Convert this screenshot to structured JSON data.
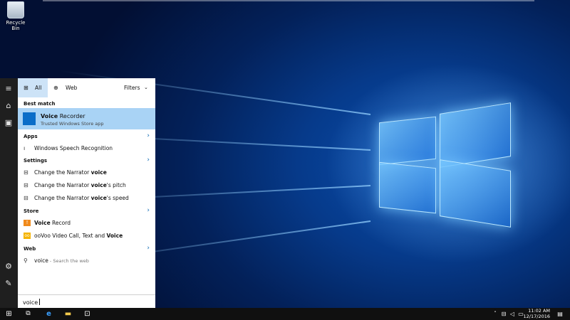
{
  "desktop": {
    "recycle_bin_label": "Recycle Bin"
  },
  "search_panel": {
    "tabs": [
      {
        "label": "All",
        "selected": true,
        "icon": "grid-icon"
      },
      {
        "label": "Web",
        "selected": false,
        "icon": "globe-icon"
      }
    ],
    "filters_label": "Filters",
    "best_match": {
      "section_label": "Best match",
      "title_bold": "Voice",
      "title_rest": " Recorder",
      "subtitle": "Trusted Windows Store app"
    },
    "apps": {
      "section_label": "Apps",
      "items": [
        "Windows Speech Recognition"
      ]
    },
    "settings": {
      "section_label": "Settings",
      "items": [
        {
          "pre": "Change the Narrator ",
          "bold": "voice",
          "post": ""
        },
        {
          "pre": "Change the Narrator ",
          "bold": "voice",
          "post": "'s pitch"
        },
        {
          "pre": "Change the Narrator ",
          "bold": "voice",
          "post": "'s speed"
        }
      ]
    },
    "store": {
      "section_label": "Store",
      "items": [
        {
          "pre": "",
          "bold": "Voice",
          "post": " Record"
        },
        {
          "pre": "ooVoo Video Call, Text and ",
          "bold": "Voice",
          "post": ""
        }
      ]
    },
    "web": {
      "section_label": "Web",
      "query": "voice",
      "hint": " - Search the web"
    },
    "search_query": "voice"
  },
  "taskbar": {
    "time": "11:02 AM",
    "date": "12/17/2016"
  },
  "colors": {
    "accent": "#0a6dc8",
    "selection": "#a9d3f5",
    "tab_selected": "#cde3f7",
    "taskbar": "#101010"
  }
}
